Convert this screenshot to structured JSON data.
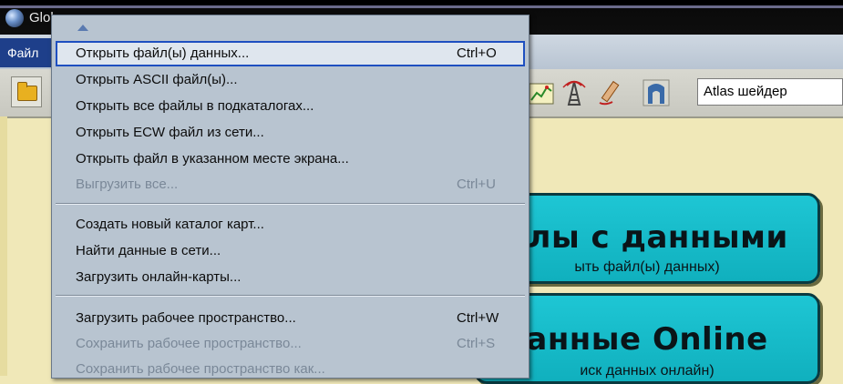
{
  "window": {
    "title": "Glob"
  },
  "menubar": {
    "file_label": "Файл"
  },
  "toolbar": {
    "search_value": "Atlas шейдер"
  },
  "file_menu": {
    "items": [
      {
        "label": "Открыть файл(ы) данных...",
        "shortcut": "Ctrl+O",
        "enabled": true,
        "highlighted": true
      },
      {
        "label": "Открыть ASCII файл(ы)...",
        "shortcut": "",
        "enabled": true
      },
      {
        "label": "Открыть все файлы в подкаталогах...",
        "shortcut": "",
        "enabled": true
      },
      {
        "label": "Открыть ECW файл из сети...",
        "shortcut": "",
        "enabled": true
      },
      {
        "label": "Открыть файл в указанном месте экрана...",
        "shortcut": "",
        "enabled": true
      },
      {
        "label": "Выгрузить все...",
        "shortcut": "Ctrl+U",
        "enabled": false
      },
      {
        "label": "Создать новый каталог карт...",
        "shortcut": "",
        "enabled": true
      },
      {
        "label": "Найти данные в сети...",
        "shortcut": "",
        "enabled": true
      },
      {
        "label": "Загрузить онлайн-карты...",
        "shortcut": "",
        "enabled": true
      },
      {
        "label": "Загрузить рабочее пространство...",
        "shortcut": "Ctrl+W",
        "enabled": true
      },
      {
        "label": "Сохранить рабочее пространство...",
        "shortcut": "Ctrl+S",
        "enabled": false
      },
      {
        "label": "Сохранить рабочее пространство как...",
        "shortcut": "",
        "enabled": false
      }
    ]
  },
  "cards": {
    "files": {
      "title": "йлы с данными",
      "subtitle": "ыть файл(ы) данных)"
    },
    "online": {
      "title": "анные Online",
      "subtitle": "иск данных онлайн)"
    }
  },
  "colors": {
    "menu_bg": "#b8c4d0",
    "highlight_border": "#1e4fc0",
    "card_bg": "#1ec6d4",
    "workspace_bg": "#f0e8b8"
  }
}
